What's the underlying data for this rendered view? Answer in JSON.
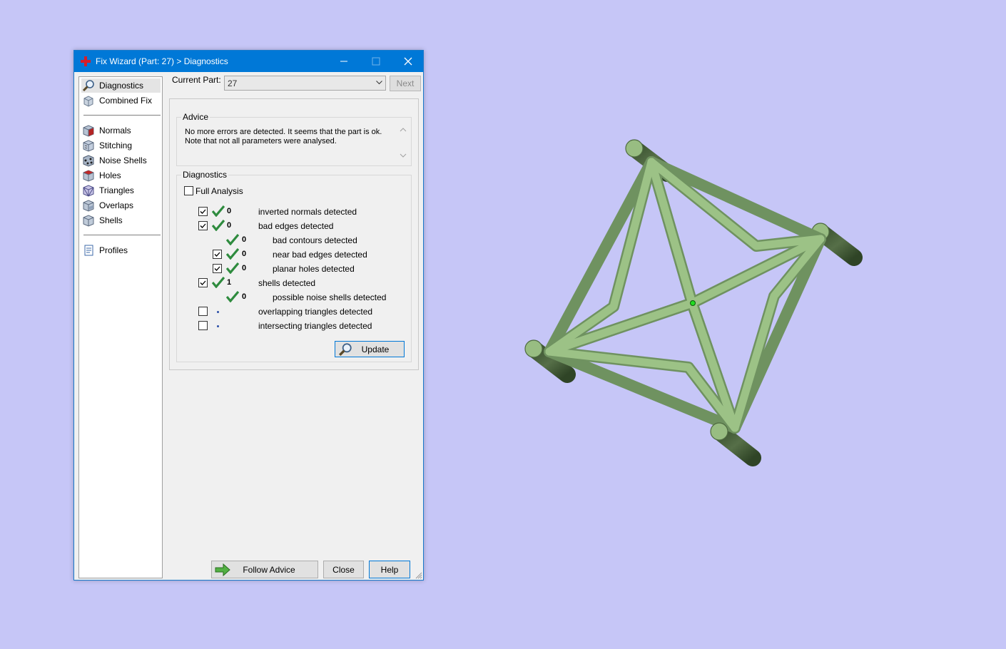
{
  "window": {
    "title": "Fix Wizard (Part: 27) > Diagnostics",
    "controls": {
      "minimize": "minimize",
      "maximize": "maximize",
      "close": "close"
    }
  },
  "nav": {
    "items_top": [
      {
        "label": "Diagnostics",
        "icon": "magnifier-icon",
        "selected": true
      },
      {
        "label": "Combined Fix",
        "icon": "cube-stack-icon"
      }
    ],
    "items_middle": [
      {
        "label": "Normals",
        "icon": "normals-cube-icon"
      },
      {
        "label": "Stitching",
        "icon": "stitching-cube-icon"
      },
      {
        "label": "Noise Shells",
        "icon": "noise-shells-icon"
      },
      {
        "label": "Holes",
        "icon": "holes-cube-icon"
      },
      {
        "label": "Triangles",
        "icon": "triangles-cube-icon"
      },
      {
        "label": "Overlaps",
        "icon": "overlaps-cube-icon"
      },
      {
        "label": "Shells",
        "icon": "shells-cube-icon"
      }
    ],
    "items_bottom": [
      {
        "label": "Profiles",
        "icon": "document-icon"
      }
    ]
  },
  "part": {
    "label": "Current Part:",
    "value": "27",
    "next_label": "Next"
  },
  "advice": {
    "title": "Advice",
    "text_line1": "No more errors are detected. It seems that the part is ok.",
    "text_line2": "Note that not all parameters were analysed."
  },
  "diagnostics": {
    "title": "Diagnostics",
    "full_analysis_label": "Full Analysis",
    "full_analysis_checked": false,
    "rows": [
      {
        "checked": true,
        "status": "check",
        "count": "0",
        "label": "inverted normals detected"
      },
      {
        "checked": true,
        "status": "check",
        "count": "0",
        "label": "bad edges detected"
      },
      {
        "checked": null,
        "status": "check",
        "count": "0",
        "label": "bad contours detected"
      },
      {
        "checked": true,
        "status": "check",
        "count": "0",
        "label": "near bad edges detected"
      },
      {
        "checked": true,
        "status": "check",
        "count": "0",
        "label": "planar holes detected"
      },
      {
        "checked": true,
        "status": "check",
        "count": "1",
        "label": "shells detected"
      },
      {
        "checked": null,
        "status": "check",
        "count": "0",
        "label": "possible noise shells detected"
      },
      {
        "checked": false,
        "status": "dot",
        "count": "",
        "label": "overlapping triangles detected"
      },
      {
        "checked": false,
        "status": "dot",
        "count": "",
        "label": "intersecting triangles detected"
      }
    ],
    "update_label": "Update"
  },
  "footer": {
    "follow_advice_label": "Follow Advice",
    "close_label": "Close",
    "help_label": "Help"
  },
  "colors": {
    "desktop": "#c6c6f7",
    "titlebar": "#0078d7",
    "model_light": "#98bd82",
    "model_dark": "#4e6b40",
    "check_green": "#2e8b3e"
  }
}
